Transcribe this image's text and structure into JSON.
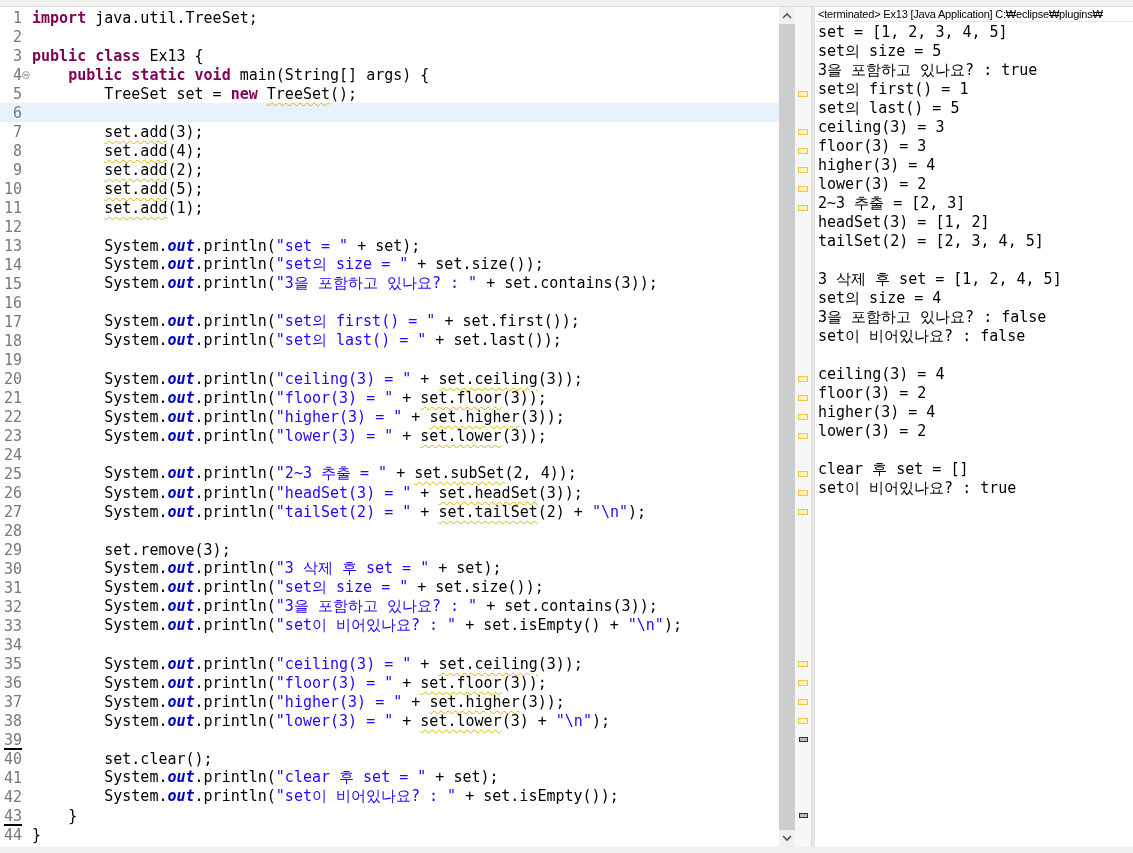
{
  "editor": {
    "lines": [
      {
        "number": "1",
        "segments": [
          {
            "kind": "keyword",
            "text": "import"
          },
          {
            "kind": "plain",
            "text": " java.util.TreeSet;"
          }
        ]
      },
      {
        "number": "2"
      },
      {
        "number": "3",
        "segments": [
          {
            "kind": "keyword",
            "text": "public "
          },
          {
            "kind": "keyword",
            "text": "class"
          },
          {
            "kind": "plain",
            "text": " Ex13 {"
          }
        ]
      },
      {
        "number": "4",
        "foldable": true,
        "segments": [
          {
            "kind": "keyword",
            "text": "    public static void"
          },
          {
            "kind": "plain",
            "text": " main(String[] args) {"
          }
        ]
      },
      {
        "number": "5",
        "warning": true,
        "segments": [
          {
            "kind": "plain",
            "text": "        TreeSet set = "
          },
          {
            "kind": "keyword",
            "text": "new "
          },
          {
            "kind": "warn",
            "text": "TreeSet"
          },
          {
            "kind": "plain",
            "text": "();"
          }
        ]
      },
      {
        "number": "6",
        "current": true
      },
      {
        "number": "7",
        "warning": true,
        "segments": [
          {
            "kind": "warn",
            "text": "        set.add"
          },
          {
            "kind": "plain",
            "text": "(3);"
          }
        ]
      },
      {
        "number": "8",
        "warning": true,
        "segments": [
          {
            "kind": "warn",
            "text": "        set.add"
          },
          {
            "kind": "plain",
            "text": "(4);"
          }
        ]
      },
      {
        "number": "9",
        "warning": true,
        "segments": [
          {
            "kind": "warn",
            "text": "        set.add"
          },
          {
            "kind": "plain",
            "text": "(2);"
          }
        ]
      },
      {
        "number": "10",
        "warning": true,
        "segments": [
          {
            "kind": "warn",
            "text": "        set.add"
          },
          {
            "kind": "plain",
            "text": "(5);"
          }
        ]
      },
      {
        "number": "11",
        "warning": true,
        "segments": [
          {
            "kind": "warn",
            "text": "        set.add"
          },
          {
            "kind": "plain",
            "text": "(1);"
          }
        ]
      },
      {
        "number": "12"
      },
      {
        "number": "13",
        "segments": [
          {
            "kind": "plain",
            "text": "        System."
          },
          {
            "kind": "field",
            "text": "out"
          },
          {
            "kind": "plain",
            "text": ".println("
          },
          {
            "kind": "string",
            "text": "\"set = \""
          },
          {
            "kind": "plain",
            "text": " + set);"
          }
        ]
      },
      {
        "number": "14",
        "segments": [
          {
            "kind": "plain",
            "text": "        System."
          },
          {
            "kind": "field",
            "text": "out"
          },
          {
            "kind": "plain",
            "text": ".println("
          },
          {
            "kind": "string",
            "text": "\"set의 size = \""
          },
          {
            "kind": "plain",
            "text": " + set.size());"
          }
        ]
      },
      {
        "number": "15",
        "segments": [
          {
            "kind": "plain",
            "text": "        System."
          },
          {
            "kind": "field",
            "text": "out"
          },
          {
            "kind": "plain",
            "text": ".println("
          },
          {
            "kind": "string",
            "text": "\"3을 포함하고 있나요? : \""
          },
          {
            "kind": "plain",
            "text": " + set.contains(3));"
          }
        ]
      },
      {
        "number": "16"
      },
      {
        "number": "17",
        "segments": [
          {
            "kind": "plain",
            "text": "        System."
          },
          {
            "kind": "field",
            "text": "out"
          },
          {
            "kind": "plain",
            "text": ".println("
          },
          {
            "kind": "string",
            "text": "\"set의 first() = \""
          },
          {
            "kind": "plain",
            "text": " + set.first());"
          }
        ]
      },
      {
        "number": "18",
        "segments": [
          {
            "kind": "plain",
            "text": "        System."
          },
          {
            "kind": "field",
            "text": "out"
          },
          {
            "kind": "plain",
            "text": ".println("
          },
          {
            "kind": "string",
            "text": "\"set의 last() = \""
          },
          {
            "kind": "plain",
            "text": " + set.last());"
          }
        ]
      },
      {
        "number": "19"
      },
      {
        "number": "20",
        "warning": true,
        "segments": [
          {
            "kind": "plain",
            "text": "        System."
          },
          {
            "kind": "field",
            "text": "out"
          },
          {
            "kind": "plain",
            "text": ".println("
          },
          {
            "kind": "string",
            "text": "\"ceiling(3) = \""
          },
          {
            "kind": "plain",
            "text": " + "
          },
          {
            "kind": "warn",
            "text": "set.ceiling"
          },
          {
            "kind": "plain",
            "text": "(3));"
          }
        ]
      },
      {
        "number": "21",
        "warning": true,
        "segments": [
          {
            "kind": "plain",
            "text": "        System."
          },
          {
            "kind": "field",
            "text": "out"
          },
          {
            "kind": "plain",
            "text": ".println("
          },
          {
            "kind": "string",
            "text": "\"floor(3) = \""
          },
          {
            "kind": "plain",
            "text": " + "
          },
          {
            "kind": "warn",
            "text": "set.floor"
          },
          {
            "kind": "plain",
            "text": "(3));"
          }
        ]
      },
      {
        "number": "22",
        "warning": true,
        "segments": [
          {
            "kind": "plain",
            "text": "        System."
          },
          {
            "kind": "field",
            "text": "out"
          },
          {
            "kind": "plain",
            "text": ".println("
          },
          {
            "kind": "string",
            "text": "\"higher(3) = \""
          },
          {
            "kind": "plain",
            "text": " + "
          },
          {
            "kind": "warn",
            "text": "set.higher"
          },
          {
            "kind": "plain",
            "text": "(3));"
          }
        ]
      },
      {
        "number": "23",
        "warning": true,
        "segments": [
          {
            "kind": "plain",
            "text": "        System."
          },
          {
            "kind": "field",
            "text": "out"
          },
          {
            "kind": "plain",
            "text": ".println("
          },
          {
            "kind": "string",
            "text": "\"lower(3) = \""
          },
          {
            "kind": "plain",
            "text": " + "
          },
          {
            "kind": "warn",
            "text": "set.lower"
          },
          {
            "kind": "plain",
            "text": "(3));"
          }
        ]
      },
      {
        "number": "24"
      },
      {
        "number": "25",
        "warning": true,
        "segments": [
          {
            "kind": "plain",
            "text": "        System."
          },
          {
            "kind": "field",
            "text": "out"
          },
          {
            "kind": "plain",
            "text": ".println("
          },
          {
            "kind": "string",
            "text": "\"2~3 추출 = \""
          },
          {
            "kind": "plain",
            "text": " + "
          },
          {
            "kind": "warn",
            "text": "set.subSet"
          },
          {
            "kind": "plain",
            "text": "(2, 4));"
          }
        ]
      },
      {
        "number": "26",
        "warning": true,
        "segments": [
          {
            "kind": "plain",
            "text": "        System."
          },
          {
            "kind": "field",
            "text": "out"
          },
          {
            "kind": "plain",
            "text": ".println("
          },
          {
            "kind": "string",
            "text": "\"headSet(3) = \""
          },
          {
            "kind": "plain",
            "text": " + "
          },
          {
            "kind": "warn",
            "text": "set.headSet"
          },
          {
            "kind": "plain",
            "text": "(3));"
          }
        ]
      },
      {
        "number": "27",
        "warning": true,
        "segments": [
          {
            "kind": "plain",
            "text": "        System."
          },
          {
            "kind": "field",
            "text": "out"
          },
          {
            "kind": "plain",
            "text": ".println("
          },
          {
            "kind": "string",
            "text": "\"tailSet(2) = \""
          },
          {
            "kind": "plain",
            "text": " + "
          },
          {
            "kind": "warn",
            "text": "set.tailSet"
          },
          {
            "kind": "plain",
            "text": "(2) + "
          },
          {
            "kind": "string",
            "text": "\"\\n\""
          },
          {
            "kind": "plain",
            "text": ");"
          }
        ]
      },
      {
        "number": "28"
      },
      {
        "number": "29",
        "segments": [
          {
            "kind": "plain",
            "text": "        set.remove(3);"
          }
        ]
      },
      {
        "number": "30",
        "segments": [
          {
            "kind": "plain",
            "text": "        System."
          },
          {
            "kind": "field",
            "text": "out"
          },
          {
            "kind": "plain",
            "text": ".println("
          },
          {
            "kind": "string",
            "text": "\"3 삭제 후 set = \""
          },
          {
            "kind": "plain",
            "text": " + set);"
          }
        ]
      },
      {
        "number": "31",
        "segments": [
          {
            "kind": "plain",
            "text": "        System."
          },
          {
            "kind": "field",
            "text": "out"
          },
          {
            "kind": "plain",
            "text": ".println("
          },
          {
            "kind": "string",
            "text": "\"set의 size = \""
          },
          {
            "kind": "plain",
            "text": " + set.size());"
          }
        ]
      },
      {
        "number": "32",
        "segments": [
          {
            "kind": "plain",
            "text": "        System."
          },
          {
            "kind": "field",
            "text": "out"
          },
          {
            "kind": "plain",
            "text": ".println("
          },
          {
            "kind": "string",
            "text": "\"3을 포함하고 있나요? : \""
          },
          {
            "kind": "plain",
            "text": " + set.contains(3));"
          }
        ]
      },
      {
        "number": "33",
        "segments": [
          {
            "kind": "plain",
            "text": "        System."
          },
          {
            "kind": "field",
            "text": "out"
          },
          {
            "kind": "plain",
            "text": ".println("
          },
          {
            "kind": "string",
            "text": "\"set이 비어있나요? : \""
          },
          {
            "kind": "plain",
            "text": " + set.isEmpty() + "
          },
          {
            "kind": "string",
            "text": "\"\\n\""
          },
          {
            "kind": "plain",
            "text": ");"
          }
        ]
      },
      {
        "number": "34"
      },
      {
        "number": "35",
        "warning": true,
        "segments": [
          {
            "kind": "plain",
            "text": "        System."
          },
          {
            "kind": "field",
            "text": "out"
          },
          {
            "kind": "plain",
            "text": ".println("
          },
          {
            "kind": "string",
            "text": "\"ceiling(3) = \""
          },
          {
            "kind": "plain",
            "text": " + "
          },
          {
            "kind": "warn",
            "text": "set.ceiling"
          },
          {
            "kind": "plain",
            "text": "(3));"
          }
        ]
      },
      {
        "number": "36",
        "warning": true,
        "segments": [
          {
            "kind": "plain",
            "text": "        System."
          },
          {
            "kind": "field",
            "text": "out"
          },
          {
            "kind": "plain",
            "text": ".println("
          },
          {
            "kind": "string",
            "text": "\"floor(3) = \""
          },
          {
            "kind": "plain",
            "text": " + "
          },
          {
            "kind": "warn",
            "text": "set.floor"
          },
          {
            "kind": "plain",
            "text": "(3));"
          }
        ]
      },
      {
        "number": "37",
        "warning": true,
        "segments": [
          {
            "kind": "plain",
            "text": "        System."
          },
          {
            "kind": "field",
            "text": "out"
          },
          {
            "kind": "plain",
            "text": ".println("
          },
          {
            "kind": "string",
            "text": "\"higher(3) = \""
          },
          {
            "kind": "plain",
            "text": " + "
          },
          {
            "kind": "warn",
            "text": "set.higher"
          },
          {
            "kind": "plain",
            "text": "(3));"
          }
        ]
      },
      {
        "number": "38",
        "warning": true,
        "segments": [
          {
            "kind": "plain",
            "text": "        System."
          },
          {
            "kind": "field",
            "text": "out"
          },
          {
            "kind": "plain",
            "text": ".println("
          },
          {
            "kind": "string",
            "text": "\"lower(3) = \""
          },
          {
            "kind": "plain",
            "text": " + "
          },
          {
            "kind": "warn",
            "text": "set.lower"
          },
          {
            "kind": "plain",
            "text": "(3) + "
          },
          {
            "kind": "string",
            "text": "\"\\n\""
          },
          {
            "kind": "plain",
            "text": ");"
          }
        ]
      },
      {
        "number": "39",
        "marked": true
      },
      {
        "number": "40",
        "segments": [
          {
            "kind": "plain",
            "text": "        set.clear();"
          }
        ]
      },
      {
        "number": "41",
        "segments": [
          {
            "kind": "plain",
            "text": "        System."
          },
          {
            "kind": "field",
            "text": "out"
          },
          {
            "kind": "plain",
            "text": ".println("
          },
          {
            "kind": "string",
            "text": "\"clear 후 set = \""
          },
          {
            "kind": "plain",
            "text": " + set);"
          }
        ]
      },
      {
        "number": "42",
        "segments": [
          {
            "kind": "plain",
            "text": "        System."
          },
          {
            "kind": "field",
            "text": "out"
          },
          {
            "kind": "plain",
            "text": ".println("
          },
          {
            "kind": "string",
            "text": "\"set이 비어있나요? : \""
          },
          {
            "kind": "plain",
            "text": " + set.isEmpty());"
          }
        ]
      },
      {
        "number": "43",
        "marked": true,
        "segments": [
          {
            "kind": "plain",
            "text": "    }"
          }
        ]
      },
      {
        "number": "44",
        "segments": [
          {
            "kind": "plain",
            "text": "}"
          }
        ]
      }
    ]
  },
  "console": {
    "status": "<terminated> Ex13 [Java Application] C:₩eclipse₩plugins₩",
    "blocks": [
      [
        "set = [1, 2, 3, 4, 5]",
        "set의 size = 5",
        "3을 포함하고 있나요? : true",
        "set의 first() = 1",
        "set의 last() = 5",
        "ceiling(3) = 3",
        "floor(3) = 3",
        "higher(3) = 4",
        "lower(3) = 2",
        "2~3 추출 = [2, 3]",
        "headSet(3) = [1, 2]",
        "tailSet(2) = [2, 3, 4, 5]"
      ],
      [
        "3 삭제 후 set = [1, 2, 4, 5]",
        "set의 size = 4",
        "3을 포함하고 있나요? : false",
        "set이 비어있나요? : false"
      ],
      [
        "ceiling(3) = 4",
        "floor(3) = 2",
        "higher(3) = 4",
        "lower(3) = 2"
      ],
      [
        "clear 후 set = []",
        "set이 비어있나요? : true"
      ]
    ]
  }
}
